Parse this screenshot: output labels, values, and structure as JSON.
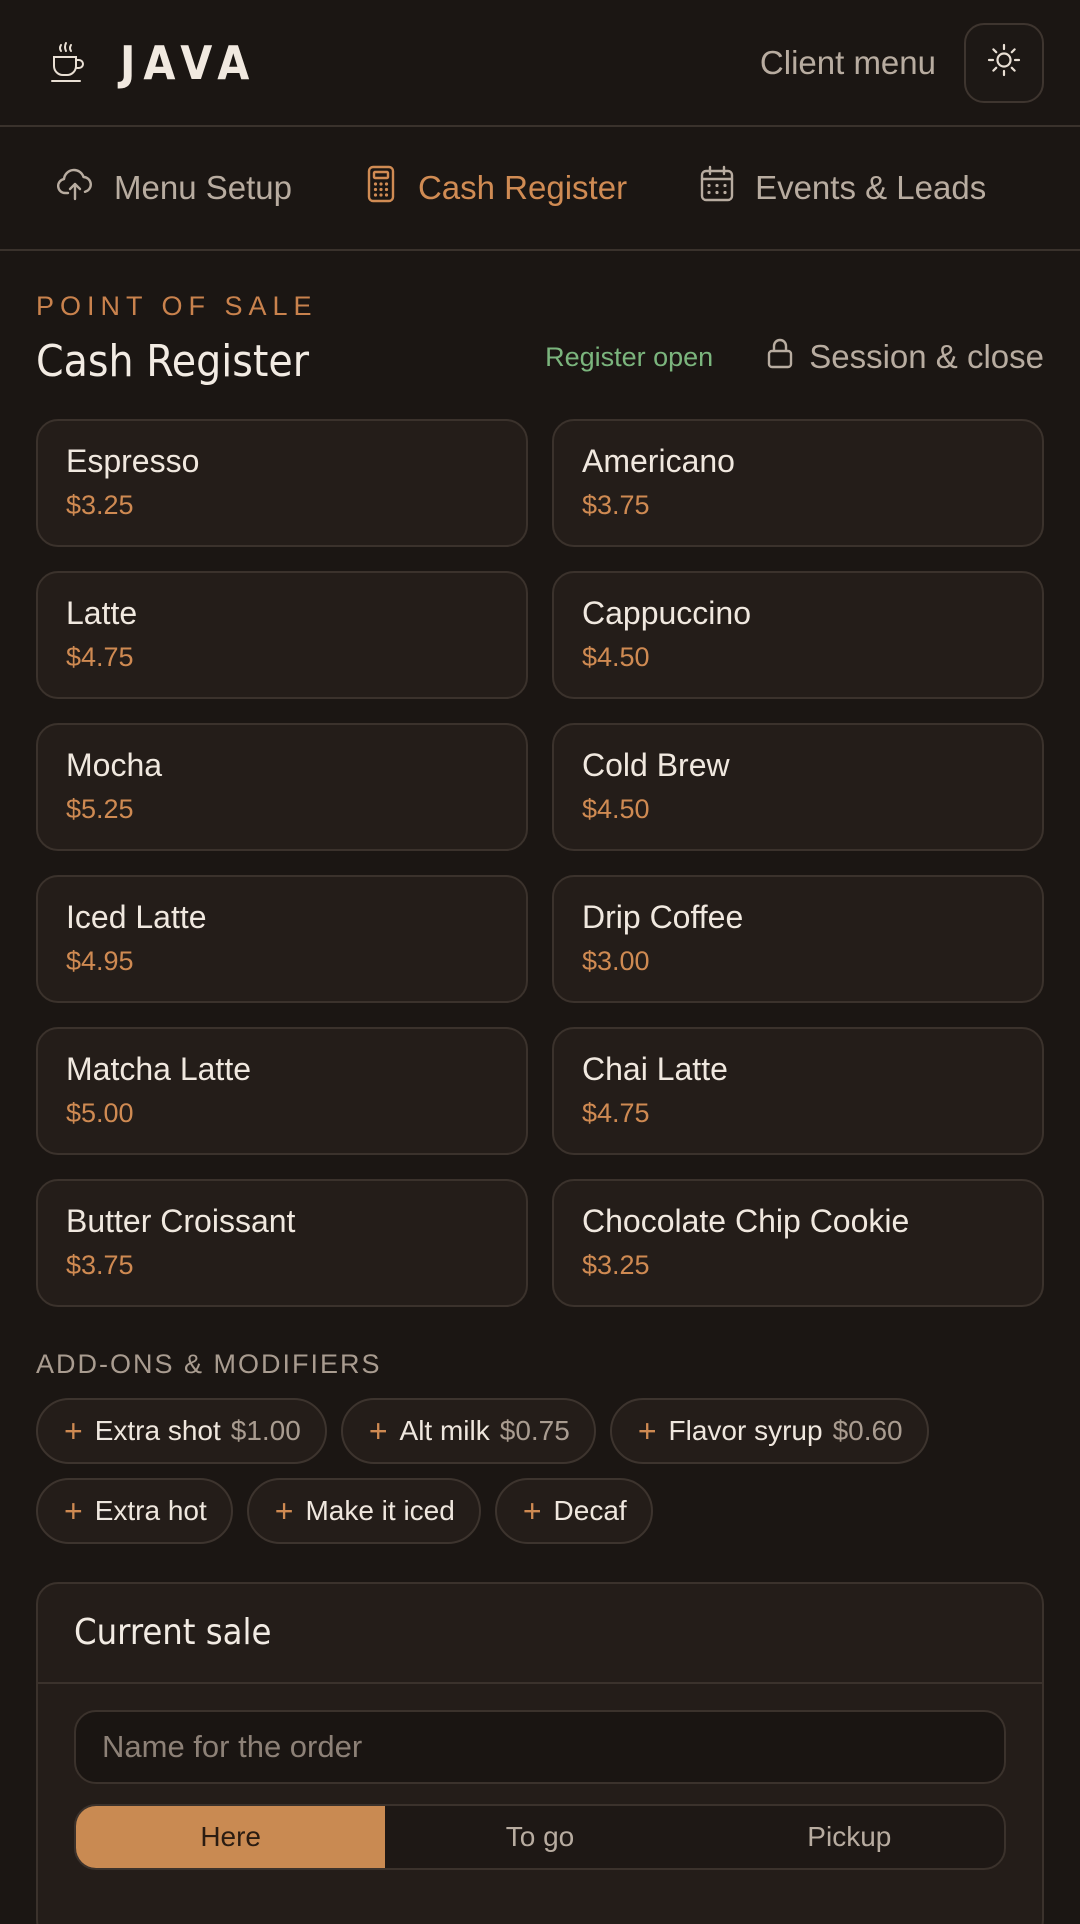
{
  "header": {
    "brand": "JAVA",
    "client_menu": "Client menu",
    "icons": {
      "logo": "coffee-cup-icon",
      "theme": "sun-icon"
    }
  },
  "nav": {
    "tabs": [
      {
        "label": "Menu Setup",
        "icon": "cloud-upload-icon",
        "active": false
      },
      {
        "label": "Cash Register",
        "icon": "calculator-icon",
        "active": true
      },
      {
        "label": "Events & Leads",
        "icon": "calendar-icon",
        "active": false
      }
    ]
  },
  "page": {
    "eyebrow": "POINT OF SALE",
    "title": "Cash Register",
    "status": "Register open",
    "session_label": "Session & close"
  },
  "products": [
    {
      "name": "Espresso",
      "price": "$3.25"
    },
    {
      "name": "Americano",
      "price": "$3.75"
    },
    {
      "name": "Latte",
      "price": "$4.75"
    },
    {
      "name": "Cappuccino",
      "price": "$4.50"
    },
    {
      "name": "Mocha",
      "price": "$5.25"
    },
    {
      "name": "Cold Brew",
      "price": "$4.50"
    },
    {
      "name": "Iced Latte",
      "price": "$4.95"
    },
    {
      "name": "Drip Coffee",
      "price": "$3.00"
    },
    {
      "name": "Matcha Latte",
      "price": "$5.00"
    },
    {
      "name": "Chai Latte",
      "price": "$4.75"
    },
    {
      "name": "Butter Croissant",
      "price": "$3.75"
    },
    {
      "name": "Chocolate Chip Cookie",
      "price": "$3.25"
    }
  ],
  "addons": {
    "title": "ADD-ONS & MODIFIERS",
    "items": [
      {
        "label": "Extra shot",
        "price": "$1.00"
      },
      {
        "label": "Alt milk",
        "price": "$0.75"
      },
      {
        "label": "Flavor syrup",
        "price": "$0.60"
      },
      {
        "label": "Extra hot",
        "price": ""
      },
      {
        "label": "Make it iced",
        "price": ""
      },
      {
        "label": "Decaf",
        "price": ""
      }
    ]
  },
  "sale": {
    "title": "Current sale",
    "name_placeholder": "Name for the order",
    "name_value": "",
    "order_types": [
      "Here",
      "To go",
      "Pickup"
    ],
    "selected_order_type": "Here"
  },
  "colors": {
    "background": "#1b1613",
    "accent": "#d08b53",
    "success": "#7bb57d",
    "card": "#241d19"
  }
}
